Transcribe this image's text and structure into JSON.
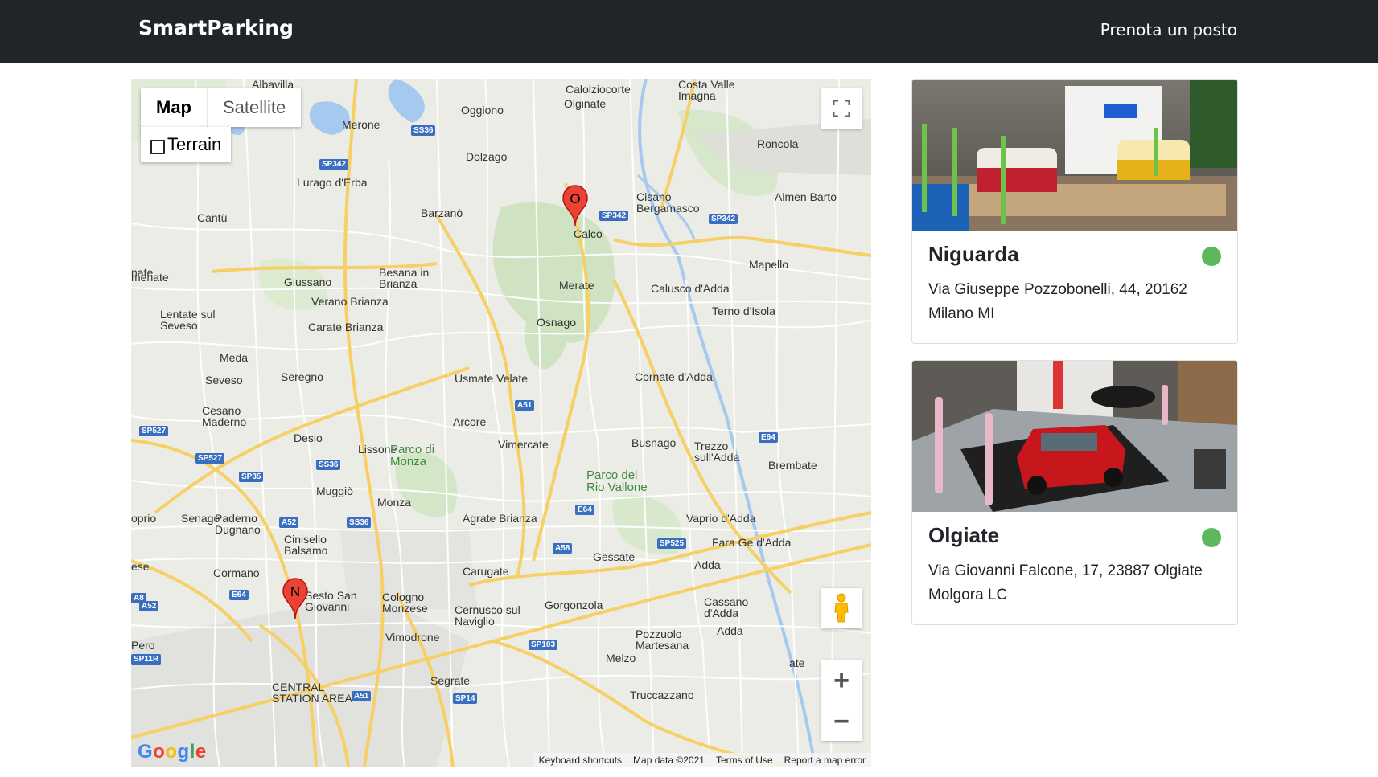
{
  "navbar": {
    "brand": "SmartParking",
    "link": "Prenota un posto"
  },
  "map": {
    "type_map": "Map",
    "type_satellite": "Satellite",
    "terrain": "Terrain",
    "zoom_in": "+",
    "zoom_out": "−",
    "logo": "Google",
    "attribution": {
      "shortcuts": "Keyboard shortcuts",
      "data": "Map data ©2021",
      "terms": "Terms of Use",
      "report": "Report a map error"
    },
    "markers": [
      {
        "label": "O"
      },
      {
        "label": "N"
      }
    ],
    "place_labels": [
      "Albavilla",
      "Calolziocorte",
      "Costa Valle Imagna",
      "Oggiono",
      "Olginate",
      "Merone",
      "SS36",
      "Dolzago",
      "Roncola",
      "SP342",
      "Lurago d'Erba",
      "Almen Barto",
      "Cisano Bergamasco",
      "Cantù",
      "Barzanò",
      "Calco",
      "SP342",
      "SP342",
      "Mapello",
      "Giussano",
      "Besana in Brianza",
      "Merate",
      "Calusco d'Adda",
      "menate",
      "Lentate sul Seveso",
      "Verano Brianza",
      "Carate Brianza",
      "Osnago",
      "Terno d'Isola",
      "Meda",
      "Seveso",
      "Seregno",
      "Usmate Velate",
      "Cornate d'Adda",
      "Cesano Maderno",
      "Arcore",
      "A51",
      "SP527",
      "Desio",
      "Lissone",
      "Parco di Monza",
      "Vimercate",
      "Busnago",
      "Trezzo sull'Adda",
      "E64",
      "Brembate",
      "SP527",
      "SS36",
      "SP35",
      "Muggiò",
      "Monza",
      "Parco del Rio Vallone",
      "Senago",
      "Paderno Dugnano",
      "SS36",
      "Agrate Brianza",
      "E64",
      "Vaprio d'Adda",
      "A52",
      "Cinisello Balsamo",
      "A58",
      "Gessate",
      "SP525",
      "Fara Ge d'Adda",
      "Cormano",
      "Carugate",
      "A8",
      "E64",
      "Sesto San Giovanni",
      "Cologno Monzese",
      "Cernusco sul Naviglio",
      "Gorgonzola",
      "Cassano d'Adda",
      "A52",
      "Pero",
      "Vimodrone",
      "Pozzuolo Martesana",
      "SP11R",
      "SP103",
      "Melzo",
      "Segrate",
      "CENTRAL STATION AREA",
      "A51",
      "ate",
      "Adda",
      "Adda",
      "oprio",
      "SP14",
      "Truccazzano",
      "ese",
      "nate"
    ]
  },
  "cards": [
    {
      "title": "Niguarda",
      "address": "Via Giuseppe Pozzobonelli, 44, 20162 Milano MI",
      "status_color": "#5cb85c"
    },
    {
      "title": "Olgiate",
      "address": "Via Giovanni Falcone, 17, 23887 Olgiate Molgora LC",
      "status_color": "#5cb85c"
    }
  ]
}
